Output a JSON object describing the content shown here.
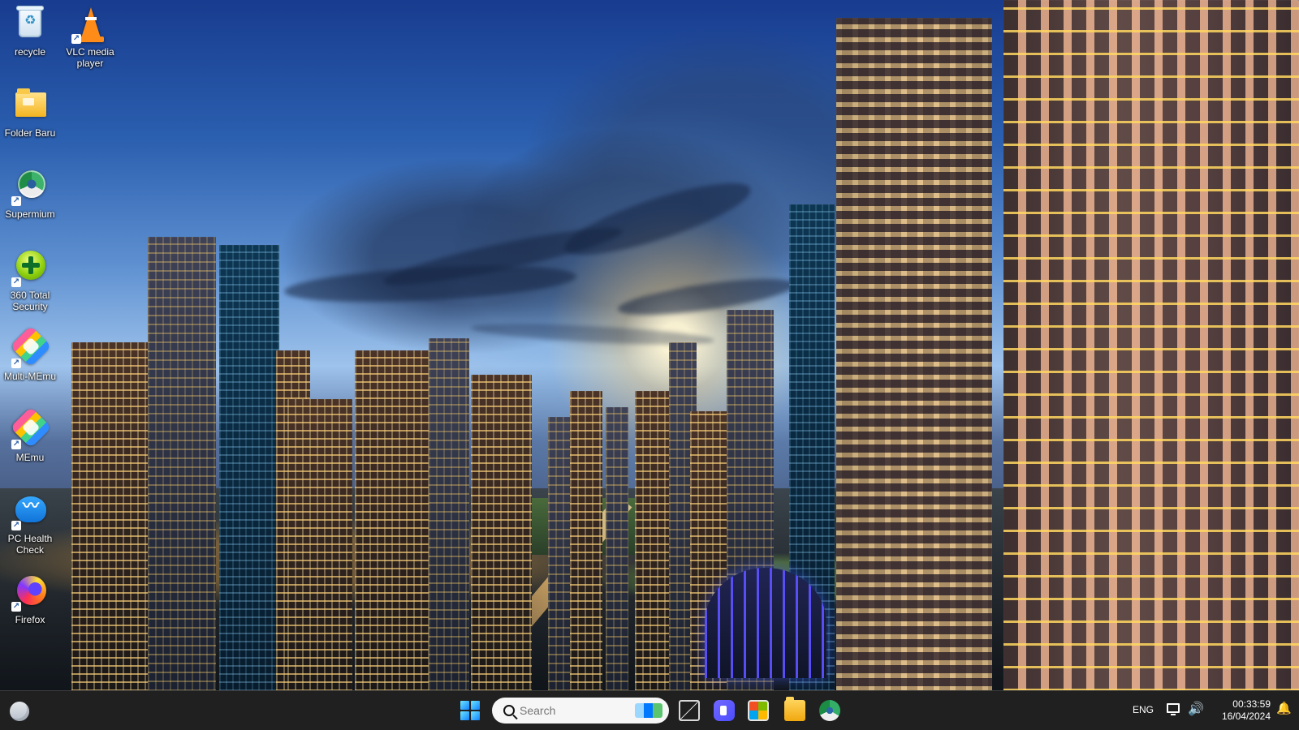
{
  "desktop": {
    "icons": [
      {
        "label": "recycle",
        "icon": "recycle-bin-icon"
      },
      {
        "label": "VLC media player",
        "icon": "vlc-icon"
      },
      {
        "label": "Folder Baru",
        "icon": "folder-icon"
      },
      {
        "label": "Supermium",
        "icon": "supermium-icon"
      },
      {
        "label": "360 Total Security",
        "icon": "security-icon"
      },
      {
        "label": "Multi-MEmu",
        "icon": "multi-memu-icon"
      },
      {
        "label": "MEmu",
        "icon": "memu-icon"
      },
      {
        "label": "PC Health Check",
        "icon": "health-check-icon"
      },
      {
        "label": "Firefox",
        "icon": "firefox-icon"
      }
    ]
  },
  "taskbar": {
    "search_placeholder": "Search",
    "language": "ENG",
    "time": "00:33:59",
    "date": "16/04/2024",
    "icons": {
      "weather": "weather-icon",
      "start": "windows-start-icon",
      "task_view": "task-view-icon",
      "video": "video-call-icon",
      "store": "store-icon",
      "explorer": "file-explorer-icon",
      "browser": "browser-icon",
      "network": "network-icon",
      "volume": "volume-icon",
      "notification": "notification-bell-icon"
    }
  },
  "colors": {
    "taskbar": "#202020",
    "search_background": "#f6f6f6",
    "start_accent": "#1281ff"
  }
}
